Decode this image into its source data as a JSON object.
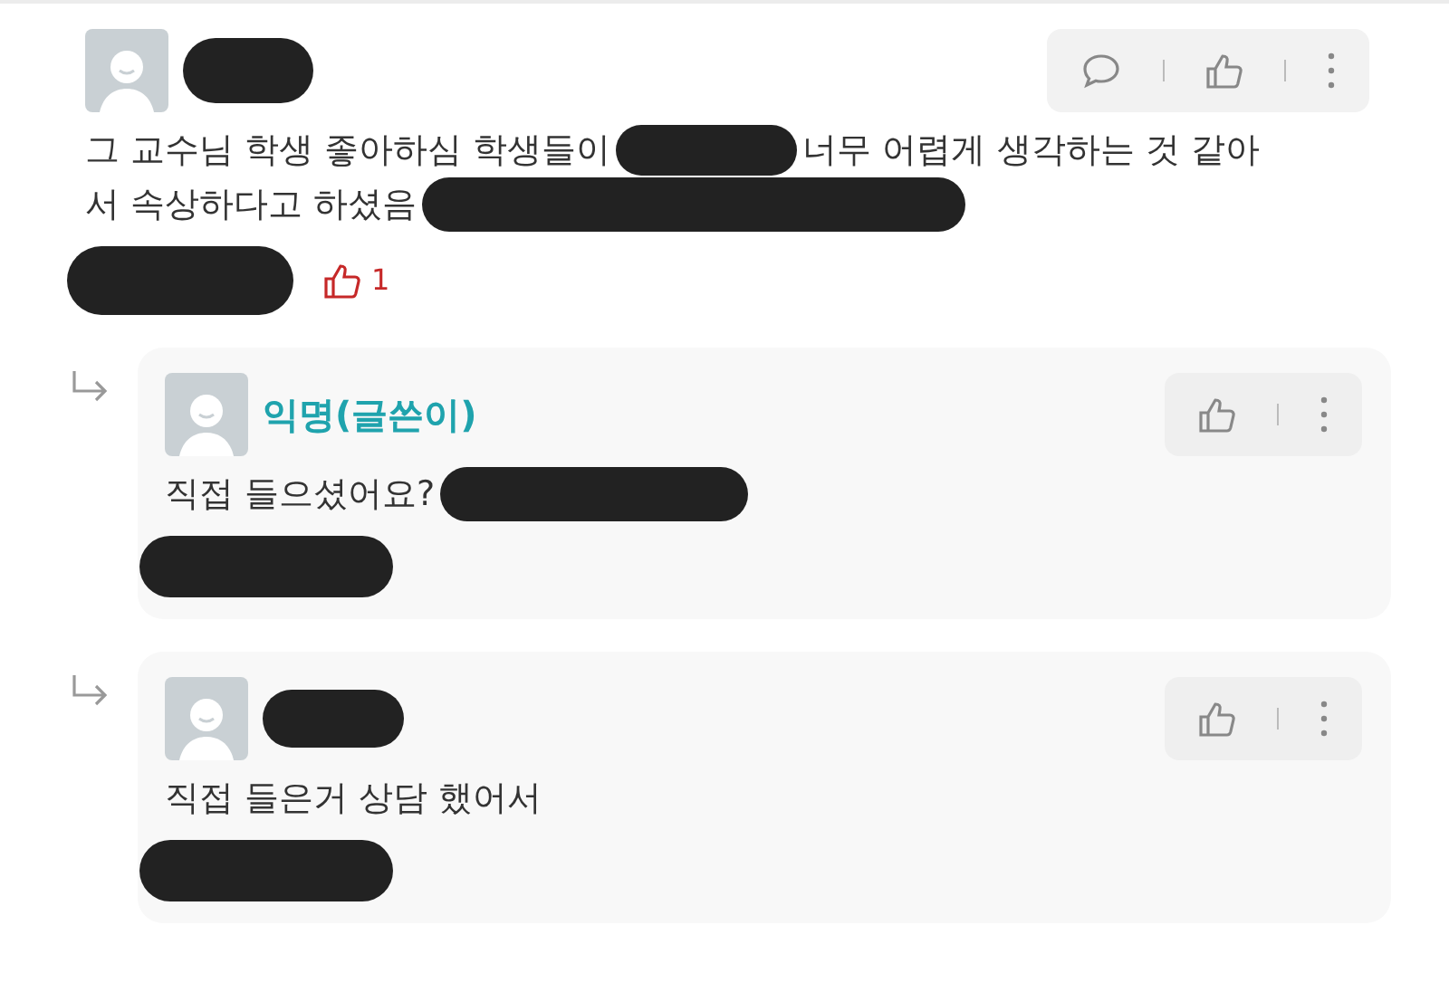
{
  "comments": [
    {
      "reply": false,
      "author_redacted": true,
      "is_writer": false,
      "actions": [
        {
          "kind": "comment"
        },
        {
          "kind": "like"
        },
        {
          "kind": "more"
        }
      ],
      "lines": [
        [
          {
            "kind": "text",
            "text": "그 교수님 학생 좋아하심 학생들이"
          },
          {
            "kind": "redaction"
          },
          {
            "kind": "text",
            "text": "너무 어렵게 생각하는 것 같아"
          }
        ],
        [
          {
            "kind": "text",
            "text": "서 속상하다고 하셨음"
          },
          {
            "kind": "redaction"
          }
        ]
      ],
      "meta_redacted": true,
      "likes": "1"
    },
    {
      "reply": true,
      "author": "익명(글쓴이)",
      "is_writer": true,
      "actions": [
        {
          "kind": "like"
        },
        {
          "kind": "more"
        }
      ],
      "lines": [
        [
          {
            "kind": "text",
            "text": "직접 들으셨어요?"
          },
          {
            "kind": "redaction"
          }
        ]
      ],
      "meta_redacted": true
    },
    {
      "reply": true,
      "author_redacted": true,
      "is_writer": false,
      "actions": [
        {
          "kind": "like"
        },
        {
          "kind": "more"
        }
      ],
      "lines": [
        [
          {
            "kind": "text",
            "text": "직접 들은거 상담 했어서"
          }
        ]
      ],
      "meta_redacted": true
    }
  ]
}
